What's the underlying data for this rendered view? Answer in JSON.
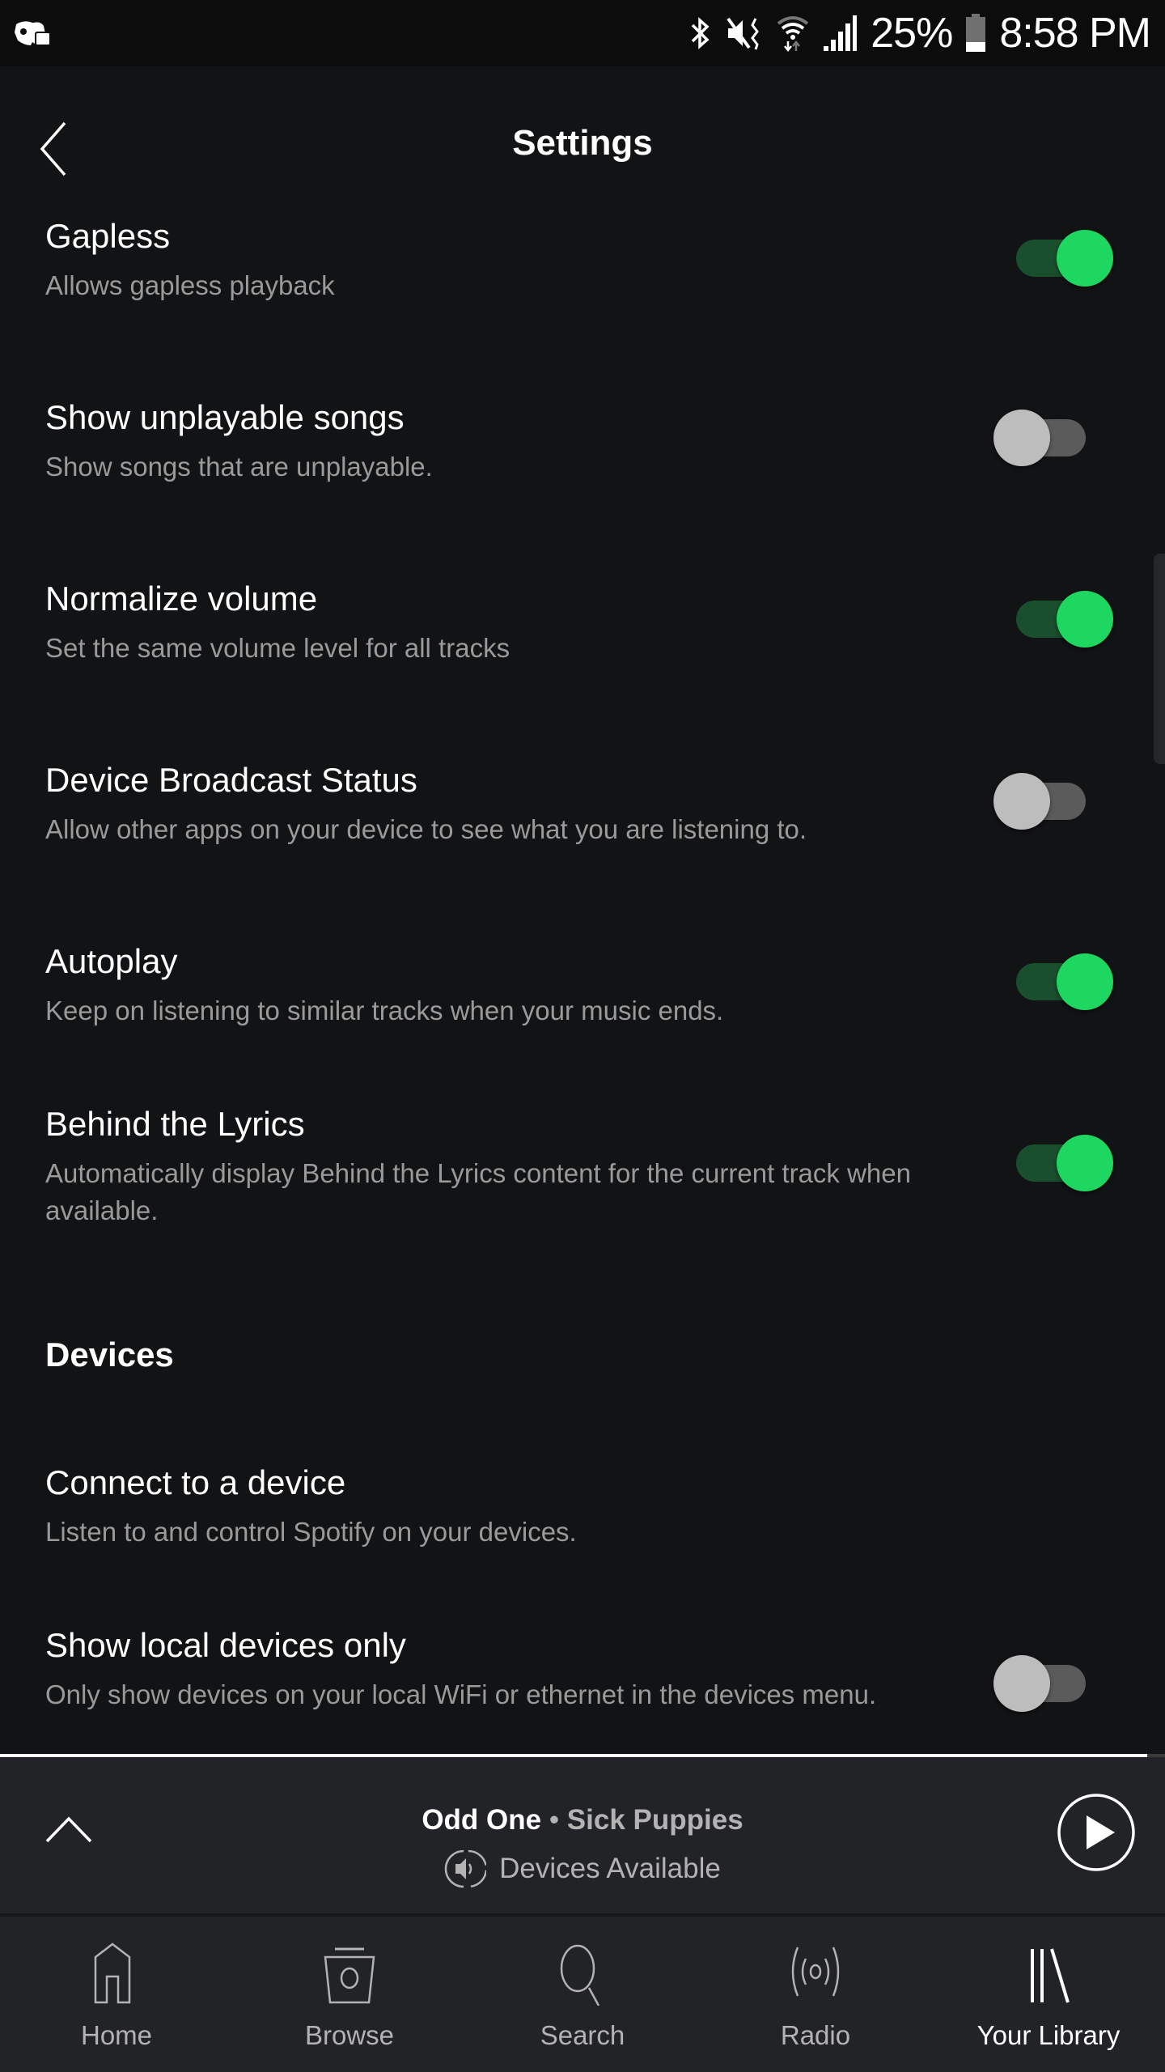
{
  "status_bar": {
    "left_icon": "discord-notification-icon",
    "icons": [
      "bluetooth-icon",
      "vibrate-mute-icon",
      "wifi-icon",
      "cell-signal-icon"
    ],
    "battery_percent": "25%",
    "battery_icon": "battery-icon",
    "time": "8:58 PM"
  },
  "header": {
    "title": "Settings",
    "back_icon": "back-chevron-icon"
  },
  "settings": [
    {
      "title": "Gapless",
      "subtitle": "Allows gapless playback",
      "toggle": true
    },
    {
      "title": "Show unplayable songs",
      "subtitle": "Show songs that are unplayable.",
      "toggle": false
    },
    {
      "title": "Normalize volume",
      "subtitle": "Set the same volume level for all tracks",
      "toggle": true
    },
    {
      "title": "Device Broadcast Status",
      "subtitle": "Allow other apps on your device to see what you are listening to.",
      "toggle": false
    },
    {
      "title": "Autoplay",
      "subtitle": "Keep on listening to similar tracks when your music ends.",
      "toggle": true
    },
    {
      "title": "Behind the Lyrics",
      "subtitle": "Automatically display Behind the Lyrics content for the current track when available.",
      "toggle": true
    }
  ],
  "devices_section": {
    "heading": "Devices",
    "items": [
      {
        "title": "Connect to a device",
        "subtitle": "Listen to and control Spotify on your devices."
      },
      {
        "title": "Show local devices only",
        "subtitle": "Only show devices on your local WiFi or ethernet in the devices menu.",
        "toggle": false
      }
    ]
  },
  "colors": {
    "accent_green": "#1ed760",
    "track_on": "#1a4f2d",
    "track_off": "#5b5b5b",
    "knob_off": "#bdbdbd",
    "background": "#121315",
    "player_bg": "#222326"
  },
  "mini_player": {
    "song": "Odd One",
    "separator": " • ",
    "artist": "Sick Puppies",
    "devices_label": "Devices Available",
    "progress_fraction": 0.985,
    "expand_icon": "chevron-up-icon",
    "devices_icon": "speaker-icon",
    "play_icon": "play-circle-icon"
  },
  "bottom_nav": [
    {
      "label": "Home",
      "icon": "home-icon",
      "active": false
    },
    {
      "label": "Browse",
      "icon": "browse-icon",
      "active": false
    },
    {
      "label": "Search",
      "icon": "search-icon",
      "active": false
    },
    {
      "label": "Radio",
      "icon": "radio-icon",
      "active": false
    },
    {
      "label": "Your Library",
      "icon": "library-icon",
      "active": true
    }
  ]
}
